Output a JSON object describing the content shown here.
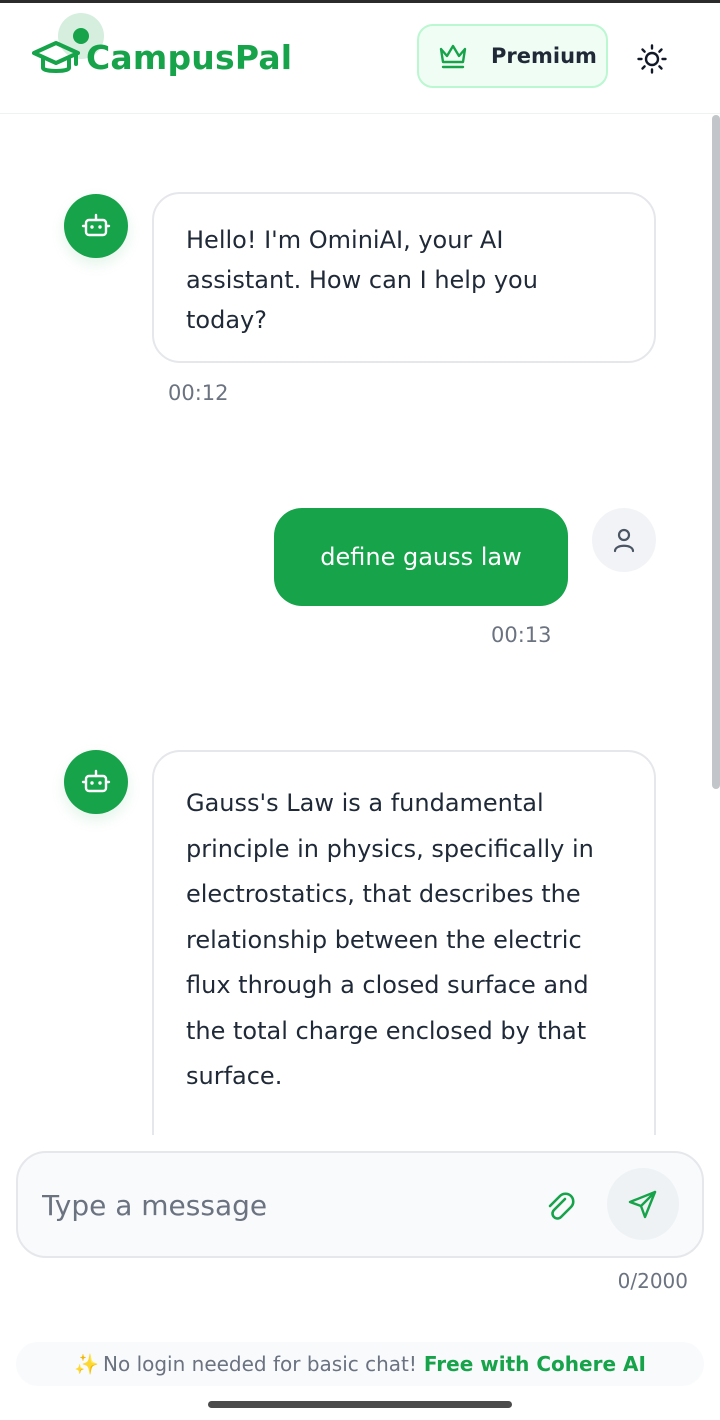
{
  "app": {
    "name": "CampusPal"
  },
  "header": {
    "premium_label": "Premium"
  },
  "messages": [
    {
      "sender": "bot",
      "text": "Hello! I'm OminiAI, your AI assistant. How can I help you today?",
      "time": "00:12"
    },
    {
      "sender": "user",
      "text": "define gauss law",
      "time": "00:13"
    },
    {
      "sender": "bot",
      "text": "Gauss's Law is a fundamental principle in physics, specifically in electrostatics, that describes the relationship between the electric flux through a closed surface and the total charge enclosed by that surface.",
      "time": ""
    }
  ],
  "composer": {
    "placeholder": "Type a message",
    "value": "",
    "char_count": "0/2000"
  },
  "notice": {
    "sparkle": "✨",
    "text": "No login needed for basic chat!",
    "link_text": "Free with Cohere AI"
  },
  "colors": {
    "brand": "#16a34a",
    "brand_light": "#bbf7d0",
    "muted_text": "#6b7280",
    "bubble_border": "#e5e7eb"
  },
  "icons": {
    "brand": "graduation-cap-icon",
    "premium": "crown-icon",
    "theme": "sun-icon",
    "bot": "robot-icon",
    "user": "user-icon",
    "attach": "paperclip-icon",
    "send": "send-icon"
  }
}
